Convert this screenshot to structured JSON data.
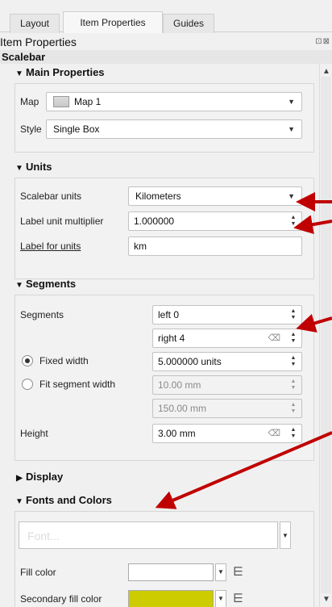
{
  "tabs": [
    {
      "label": "Layout"
    },
    {
      "label": "Item Properties"
    },
    {
      "label": "Guides"
    }
  ],
  "panel": {
    "title": "Item Properties",
    "header": "Scalebar",
    "buttons": "⊡⊠"
  },
  "main_properties": {
    "title": "Main Properties",
    "map_label": "Map",
    "map_value": "Map 1",
    "style_label": "Style",
    "style_value": "Single Box"
  },
  "units": {
    "title": "Units",
    "scalebar_units_label": "Scalebar units",
    "scalebar_units_value": "Kilometers",
    "multiplier_label": "Label unit multiplier",
    "multiplier_value": "1.000000",
    "label_for_units_label": "Label for units",
    "label_for_units_value": "km"
  },
  "segments": {
    "title": "Segments",
    "segments_label": "Segments",
    "left_value": "left 0",
    "right_value": "right 4",
    "fixed_width_label": "Fixed width",
    "fixed_width_value": "5.000000 units",
    "fit_width_label": "Fit segment width",
    "fit_min_value": "10.00 mm",
    "fit_max_value": "150.00 mm",
    "height_label": "Height",
    "height_value": "3.00 mm"
  },
  "display": {
    "title": "Display"
  },
  "fonts_colors": {
    "title": "Fonts and Colors",
    "font_button": "Font...",
    "fill_color_label": "Fill color",
    "fill_color": "#ffffff",
    "secondary_fill_label": "Secondary fill color",
    "secondary_fill_color": "#cccc00"
  },
  "colors": {
    "annotation_arrow": "#c00000"
  }
}
